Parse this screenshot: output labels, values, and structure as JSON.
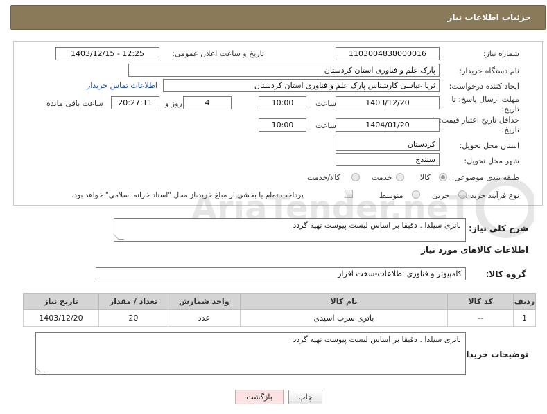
{
  "header": {
    "title": "جزئیات اطلاعات نیاز"
  },
  "form": {
    "need_number_label": "شماره نیاز:",
    "need_number": "1103004838000016",
    "announce_label": "تاریخ و ساعت اعلان عمومی:",
    "announce_value": "1403/12/15 - 12:25",
    "buyer_label": "نام دستگاه خریدار:",
    "buyer_value": "پارک علم و فناوری استان کردستان",
    "creator_label": "ایجاد کننده درخواست:",
    "creator_value": "ثریا عباسی کارشناس پارک علم و فناوری استان کردستان",
    "contact_link": "اطلاعات تماس خریدار",
    "reply_label_1": "مهلت ارسال پاسخ: تا",
    "reply_label_2": "تاریخ:",
    "reply_date": "1403/12/20",
    "time_label": "ساعت",
    "reply_time": "10:00",
    "days_value": "4",
    "days_label": "روز و",
    "remain_time": "20:27:11",
    "remain_label": "ساعت باقی مانده",
    "validity_label_1": "حداقل تاریخ اعتبار قیمت: تا",
    "validity_label_2": "تاریخ:",
    "validity_date": "1404/01/20",
    "validity_time": "10:00",
    "province_label": "استان محل تحویل:",
    "province_value": "کردستان",
    "city_label": "شهر محل تحویل:",
    "city_value": "سنندج",
    "category_label": "طبقه بندی موضوعی:",
    "category_options": [
      "کالا",
      "خدمت",
      "کالا/خدمت"
    ],
    "process_label": "نوع فرآیند خرید :",
    "process_options": [
      "جزیی",
      "متوسط"
    ],
    "payment_note": "پرداخت تمام یا بخشی از مبلغ خرید،از محل \"اسناد خزانه اسلامی\" خواهد بود."
  },
  "description": {
    "label": "شرح کلی نیاز:",
    "text": "باتری سیلدا . دقیقا بر اساس لیست پیوست تهیه گردد"
  },
  "goods_section": {
    "title": "اطلاعات کالاهای مورد نیاز",
    "group_label": "گروه کالا:",
    "group_value": "کامپیوتر و فناوری اطلاعات-سخت افزار"
  },
  "table": {
    "headers": [
      "ردیف",
      "کد کالا",
      "نام کالا",
      "واحد شمارش",
      "تعداد / مقدار",
      "تاریخ نیاز"
    ],
    "rows": [
      [
        "1",
        "--",
        "باتری سرب اسیدی",
        "عدد",
        "20",
        "1403/12/20"
      ]
    ]
  },
  "buyer_notes": {
    "label": "توضیحات خریدار:",
    "text": "باتری سیلدا . دقیقا بر اساس لیست پیوست تهیه گردد"
  },
  "buttons": {
    "print": "چاپ",
    "back": "بازگشت"
  },
  "watermark": "AriaTender.neT",
  "colors": {
    "header_bg": "#8b7a59",
    "link": "#1a4fa0",
    "back_button_bg": "#fbe3e3"
  }
}
